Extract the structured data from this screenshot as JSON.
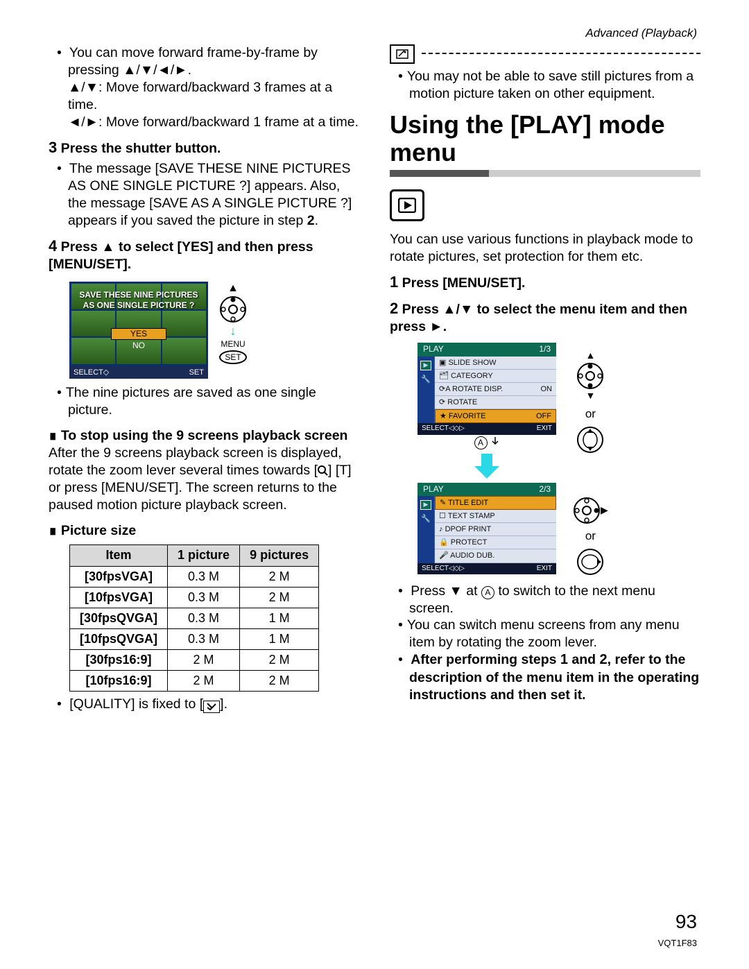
{
  "header": {
    "section": "Advanced (Playback)"
  },
  "left": {
    "frame_intro": "You can move forward frame-by-frame by pressing ",
    "frame_arrows": "▲/▼/◄/►.",
    "move3": ": Move forward/backward 3 frames at a time.",
    "move3_arrows": "▲/▼",
    "move1": ": Move forward/backward 1 frame at a time.",
    "move1_arrows": "◄/►",
    "step3_num": "3",
    "step3": "Press the shutter button.",
    "step3_body": "The message [SAVE THESE NINE PICTURES AS ONE SINGLE PICTURE ?] appears. Also, the message [SAVE AS A SINGLE PICTURE ?] appears if you saved the picture in step ",
    "step3_body_end": ".",
    "step3_ref": "2",
    "step4_num": "4",
    "step4_a": "Press ",
    "step4_arrow": "▲",
    "step4_b": " to select [YES] and then press [MENU/SET].",
    "lcd1": {
      "line1": "SAVE THESE NINE PICTURES",
      "line2": "AS ONE SINGLE PICTURE ?",
      "yes": "YES",
      "no": "NO",
      "select": "SELECT",
      "set": "SET",
      "menu_label": "MENU",
      "set_label": "SET"
    },
    "nine_saved": "The nine pictures are saved as one single picture.",
    "stop_heading": " To stop using the 9 screens playback screen",
    "stop_body_a": "After the 9 screens playback screen is displayed, rotate the zoom lever several times towards [",
    "stop_body_b": "] [T] or press [MENU/SET]. The screen returns to the paused motion picture playback screen.",
    "picsize": " Picture size",
    "table": {
      "head": [
        "Item",
        "1 picture",
        "9 pictures"
      ],
      "rows": [
        [
          "[30fpsVGA]",
          "0.3 M",
          "2 M"
        ],
        [
          "[10fpsVGA]",
          "0.3 M",
          "2 M"
        ],
        [
          "[30fpsQVGA]",
          "0.3 M",
          "1 M"
        ],
        [
          "[10fpsQVGA]",
          "0.3 M",
          "1 M"
        ],
        [
          "[30fps16:9]",
          "2 M",
          "2 M"
        ],
        [
          "[10fps16:9]",
          "2 M",
          "2 M"
        ]
      ]
    },
    "quality_a": "[QUALITY] is fixed to [",
    "quality_b": "]."
  },
  "right": {
    "note_bullet": "You may not be able to save still pictures from a motion picture taken on other equipment.",
    "title": "Using the [PLAY] mode menu",
    "intro": "You can use various functions in playback mode to rotate pictures, set protection for them etc.",
    "step1_num": "1",
    "step1": "Press [MENU/SET].",
    "step2_num": "2",
    "step2_a": "Press ",
    "step2_arrows": "▲/▼",
    "step2_b": " to select the menu item and then press ",
    "step2_arrow_r": "►",
    "step2_c": ".",
    "or": "or",
    "lcd2": {
      "head": "PLAY",
      "page": "1/3",
      "items": [
        {
          "label": "SLIDE SHOW",
          "val": ""
        },
        {
          "label": "CATEGORY",
          "val": ""
        },
        {
          "label": "ROTATE DISP.",
          "val": "ON"
        },
        {
          "label": "ROTATE",
          "val": ""
        },
        {
          "label": "FAVORITE",
          "val": "OFF"
        }
      ],
      "sel_index": 4,
      "select": "SELECT",
      "exit": "EXIT"
    },
    "lcd3": {
      "head": "PLAY",
      "page": "2/3",
      "items": [
        {
          "label": "TITLE EDIT",
          "val": ""
        },
        {
          "label": "TEXT STAMP",
          "val": ""
        },
        {
          "label": "DPOF PRINT",
          "val": ""
        },
        {
          "label": "PROTECT",
          "val": ""
        },
        {
          "label": "AUDIO DUB.",
          "val": ""
        }
      ],
      "sel_index": 0,
      "select": "SELECT",
      "exit": "EXIT"
    },
    "circle_a": "A",
    "press_down_a": "Press ",
    "press_down_arrow": "▼",
    "press_down_b": " at ",
    "press_down_c": " to switch to the next menu screen.",
    "switch_zoom": "You can switch menu screens from any menu item by rotating the zoom lever.",
    "after_a": "After performing steps ",
    "after_num1": "1",
    "after_mid": " and ",
    "after_num2": "2",
    "after_b": ", refer to the description of the menu item in the operating instructions and then set it."
  },
  "footer": {
    "page": "93",
    "doc": "VQT1F83"
  }
}
